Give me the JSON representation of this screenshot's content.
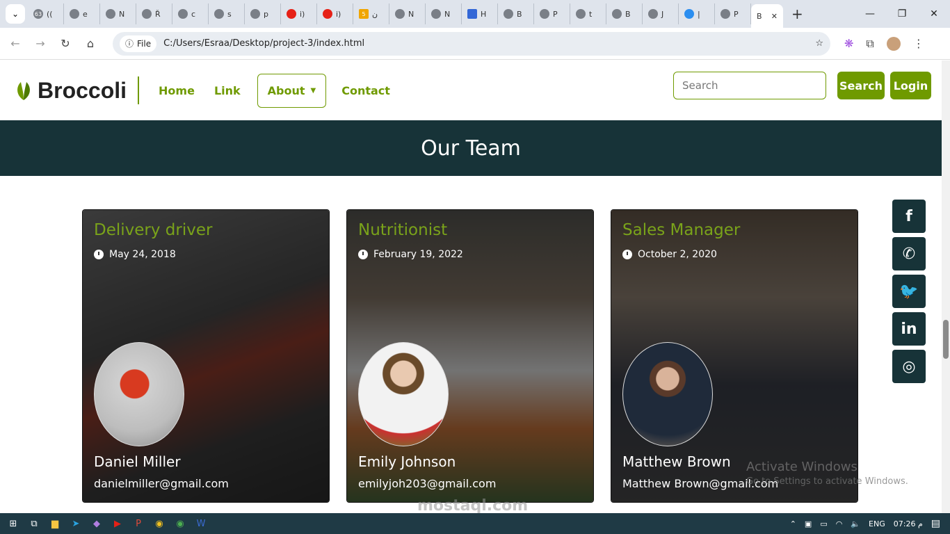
{
  "browser": {
    "tabs": [
      {
        "label": "((",
        "fav": "63"
      },
      {
        "label": "e",
        "fav": ""
      },
      {
        "label": "N",
        "fav": ""
      },
      {
        "label": "Ř",
        "fav": ""
      },
      {
        "label": "c",
        "fav": ""
      },
      {
        "label": "s",
        "fav": ""
      },
      {
        "label": "p",
        "fav": ""
      },
      {
        "label": "i)",
        "fav": ""
      },
      {
        "label": "i)",
        "fav": ""
      },
      {
        "label": "ن",
        "fav": "5"
      },
      {
        "label": "N",
        "fav": ""
      },
      {
        "label": "N",
        "fav": ""
      },
      {
        "label": "H",
        "fav": ""
      },
      {
        "label": "B",
        "fav": ""
      },
      {
        "label": "P",
        "fav": ""
      },
      {
        "label": "t",
        "fav": ""
      },
      {
        "label": "B",
        "fav": ""
      },
      {
        "label": "J",
        "fav": ""
      },
      {
        "label": "|",
        "fav": ""
      },
      {
        "label": "P",
        "fav": ""
      }
    ],
    "active_tab_label": "B",
    "address_chip": "File",
    "url": "C:/Users/Esraa/Desktop/project-3/index.html"
  },
  "navbar": {
    "brand": "Broccoli",
    "links": {
      "home": "Home",
      "link": "Link",
      "about": "About",
      "contact": "Contact"
    },
    "search_placeholder": "Search",
    "search_button": "Search",
    "login_button": "Login"
  },
  "hero": {
    "title": "Our Team"
  },
  "team": [
    {
      "role": "Delivery driver",
      "date": "May 24, 2018",
      "name": "Daniel Miller",
      "email": "danielmiller@gmail.com"
    },
    {
      "role": "Nutritionist",
      "date": "February 19, 2022",
      "name": "Emily Johnson",
      "email": "emilyjoh203@gmail.com"
    },
    {
      "role": "Sales Manager",
      "date": "October 2, 2020",
      "name": "Matthew Brown",
      "email": "Matthew Brown@gmail.com"
    }
  ],
  "watermark": {
    "line1": "Activate Windows",
    "line2": "Go to Settings to activate Windows.",
    "site": "mostaql.com"
  },
  "taskbar": {
    "lang": "ENG",
    "time": "07:26 م"
  },
  "colors": {
    "accent": "#6f9a00",
    "dark": "#173338"
  }
}
